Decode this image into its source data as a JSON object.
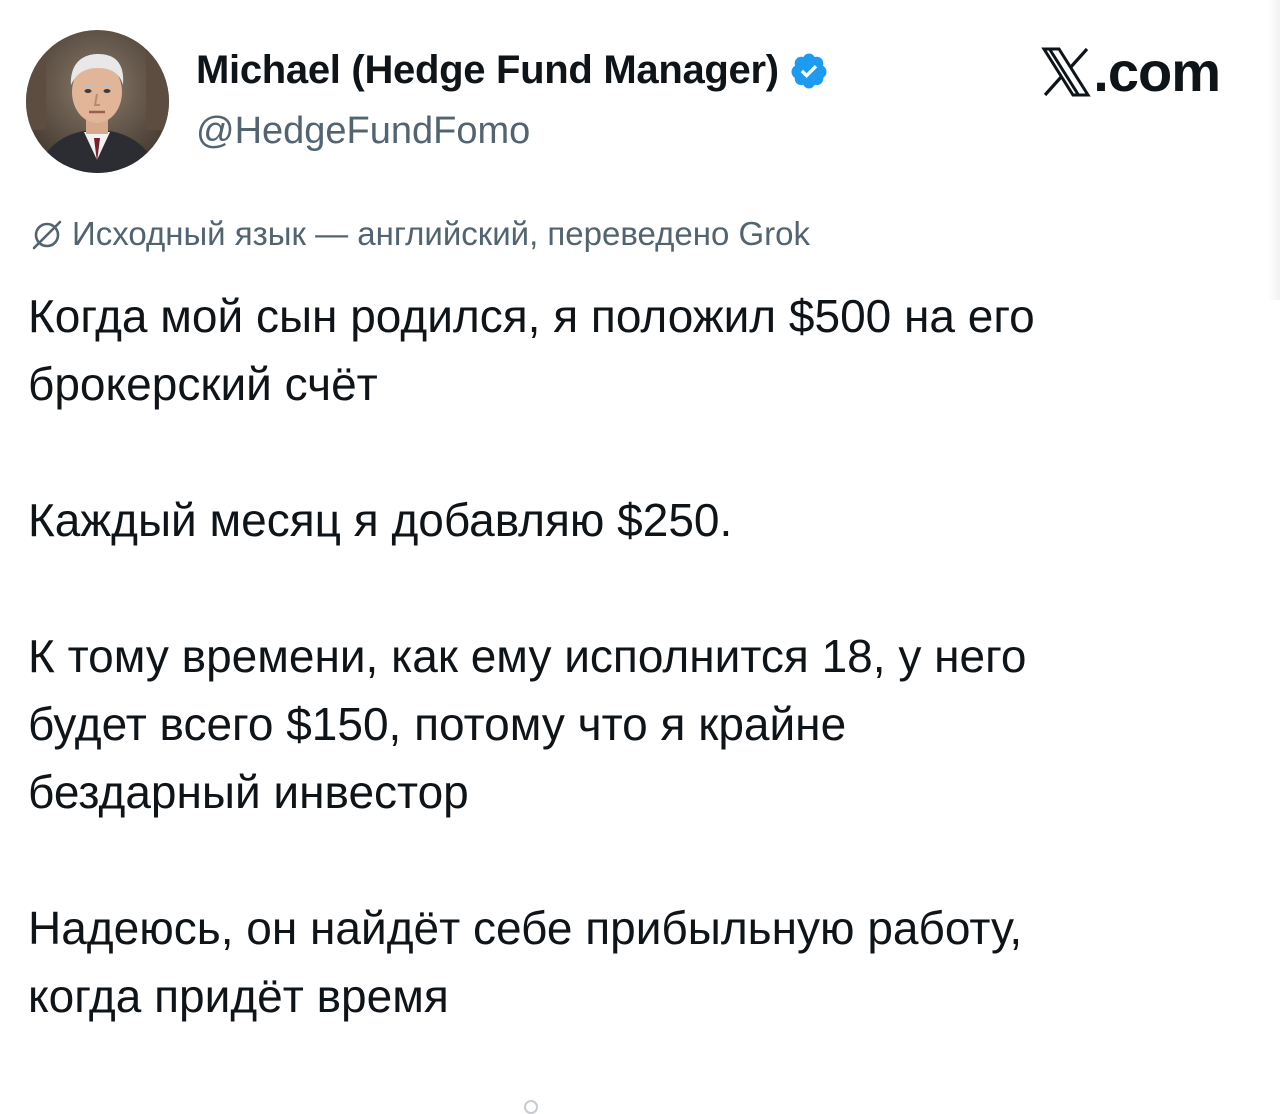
{
  "author": {
    "display_name": "Michael (Hedge Fund Manager)",
    "handle": "@HedgeFundFomo",
    "verified": true,
    "verified_color": "#1d9bf0",
    "avatar": "portrait-photo"
  },
  "brand": {
    "logo": "x-logo",
    "text": ".com"
  },
  "translation": {
    "icon": "translate-icon",
    "text": "Исходный язык — английский, переведено Grok"
  },
  "tweet": {
    "paragraphs": [
      "Когда мой сын родился, я положил $500 на его\nброкерский счёт",
      "Каждый месяц я добавляю $250.",
      "К тому времени, как ему исполнится 18, у него\nбудет всего $150, потому что я крайне\nбездарный инвестор",
      "Надеюсь, он найдёт себе прибыльную работу,\nкогда придёт время"
    ]
  },
  "colors": {
    "text_primary": "#0f1419",
    "text_secondary": "#536471",
    "background": "#ffffff"
  }
}
